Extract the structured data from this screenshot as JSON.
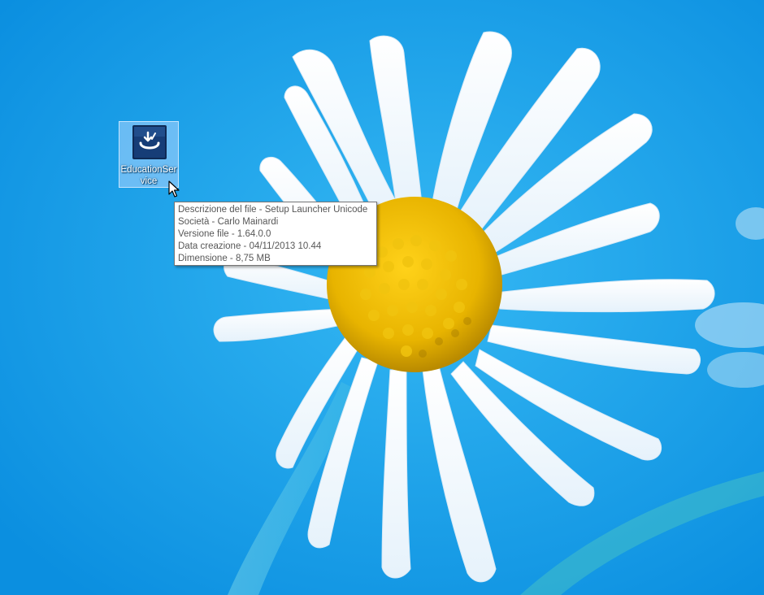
{
  "desktop": {
    "background_color": "#1aa3ec",
    "wallpaper": "daisy-flower"
  },
  "icon": {
    "label": "EducationService",
    "icon_name": "setup-launcher-app-icon",
    "selected": true
  },
  "tooltip": {
    "lines": [
      "Descrizione del file - Setup Launcher Unicode",
      "Società - Carlo Mainardi",
      "Versione file - 1.64.0.0",
      "Data creazione - 04/11/2013 10.44",
      "Dimensione - 8,75 MB"
    ]
  },
  "cursor": {
    "icon_name": "arrow-cursor-icon"
  }
}
